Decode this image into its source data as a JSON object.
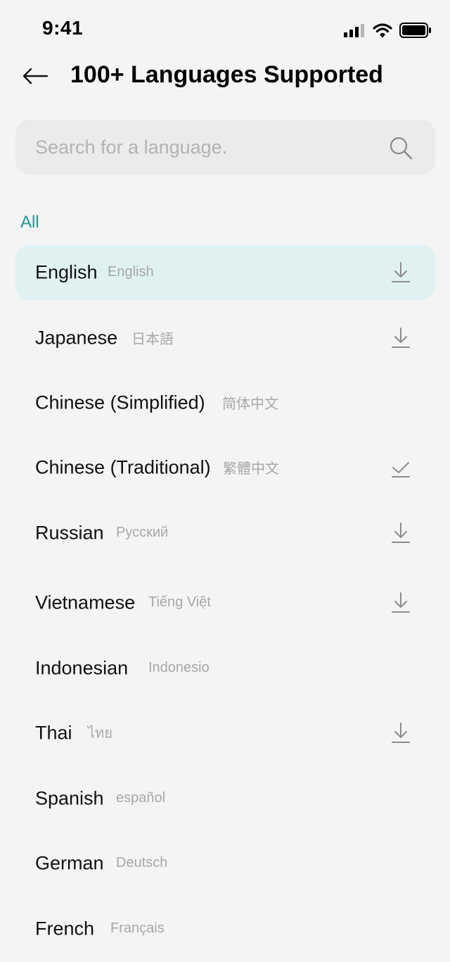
{
  "status_bar": {
    "time": "9:41"
  },
  "header": {
    "title": "100+ Languages Supported"
  },
  "search": {
    "placeholder": "Search for a language."
  },
  "section_label": "All",
  "colors": {
    "accent": "#1f9a94",
    "selected_row": "#e0f1f1",
    "background": "#f4f4f4"
  },
  "languages": [
    {
      "name": "English",
      "native": "English",
      "action": "download",
      "selected": true
    },
    {
      "name": "Japanese",
      "native": "日本語",
      "action": "download",
      "selected": false
    },
    {
      "name": "Chinese (Simplified)",
      "native": "简体中文",
      "action": "none",
      "selected": false
    },
    {
      "name": "Chinese (Traditional)",
      "native": "繁體中文",
      "action": "downloaded",
      "selected": false
    },
    {
      "name": "Russian",
      "native": "Русский",
      "action": "download",
      "selected": false
    },
    {
      "name": "Vietnamese",
      "native": "Tiếng Việt",
      "action": "download",
      "selected": false
    },
    {
      "name": "Indonesian",
      "native": "Indonesio",
      "action": "none",
      "selected": false
    },
    {
      "name": "Thai",
      "native": "ไทย",
      "action": "download",
      "selected": false
    },
    {
      "name": "Spanish",
      "native": "español",
      "action": "none",
      "selected": false
    },
    {
      "name": "German",
      "native": "Deutsch",
      "action": "none",
      "selected": false
    },
    {
      "name": "French",
      "native": "Français",
      "action": "none",
      "selected": false
    }
  ]
}
